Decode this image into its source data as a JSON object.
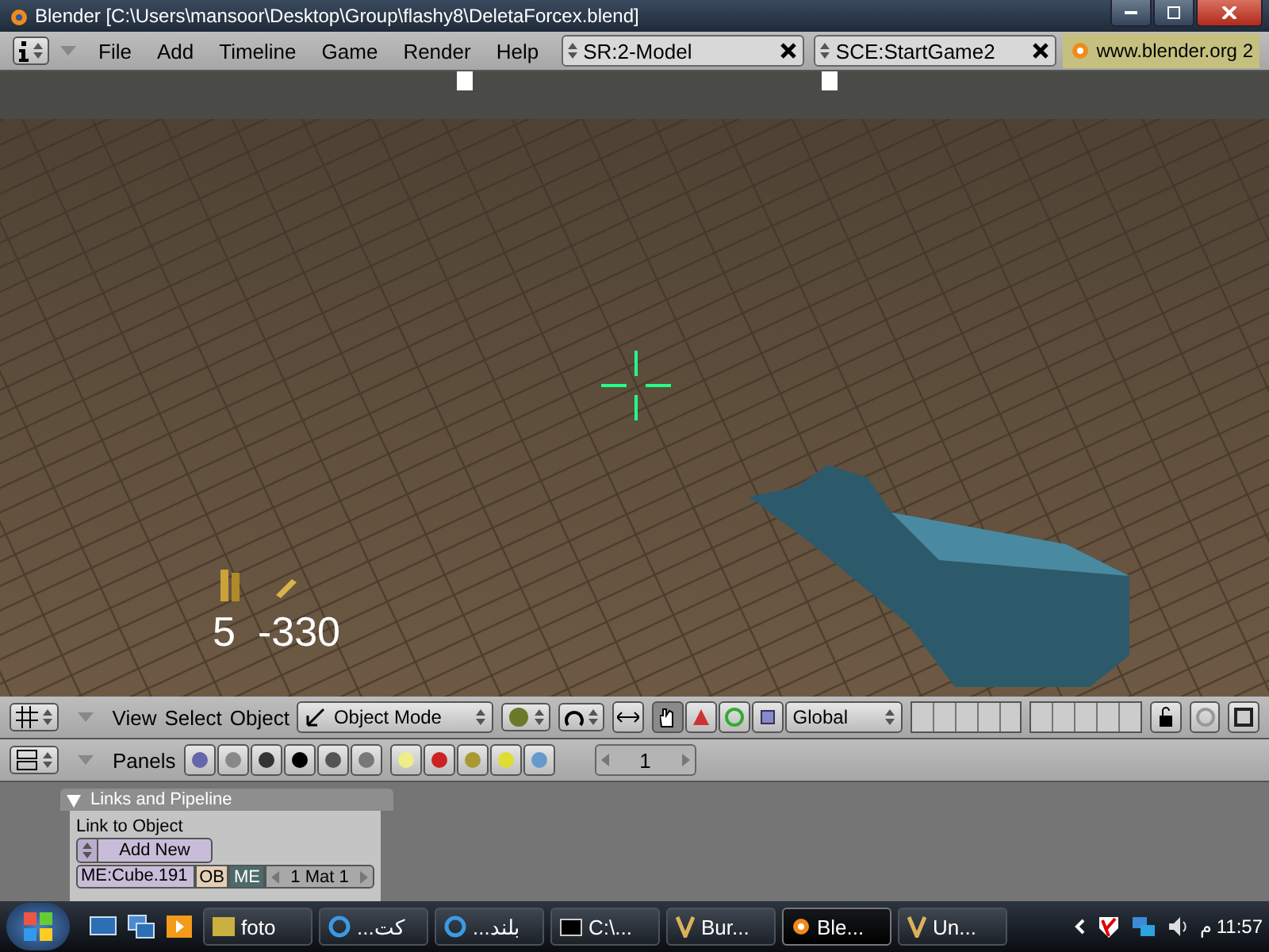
{
  "window": {
    "title": "Blender [C:\\Users\\mansoor\\Desktop\\Group\\flashy8\\DeletaForcex.blend]"
  },
  "menu_bar": {
    "menus": [
      "File",
      "Add",
      "Timeline",
      "Game",
      "Render",
      "Help"
    ],
    "screen": "SR:2-Model",
    "scene": "SCE:StartGame2",
    "link": "www.blender.org 2"
  },
  "viewport": {
    "hud": {
      "clip": "5",
      "reserve": "-330"
    }
  },
  "view3d_header": {
    "menus": [
      "View",
      "Select",
      "Object"
    ],
    "mode": "Object Mode",
    "orientation": "Global"
  },
  "buttons_header": {
    "label": "Panels",
    "frame": "1"
  },
  "panel": {
    "title": "Links and Pipeline",
    "expanded": true,
    "link_label": "Link to Object",
    "add_button": "Add New",
    "mesh_name": "ME:Cube.191",
    "toggles": [
      {
        "label": "OB",
        "selected": false
      },
      {
        "label": "ME",
        "selected": true
      }
    ],
    "material": "1 Mat 1"
  },
  "taskbar": {
    "items": [
      {
        "label": "foto",
        "selected": false
      },
      {
        "label": "كت...",
        "selected": false
      },
      {
        "label": "بلند...",
        "selected": false
      },
      {
        "label": "C:\\...",
        "selected": false
      },
      {
        "label": "Bur...",
        "selected": false
      },
      {
        "label": "Ble...",
        "selected": true
      },
      {
        "label": "Un...",
        "selected": false
      }
    ],
    "clock": "11:57 م"
  }
}
